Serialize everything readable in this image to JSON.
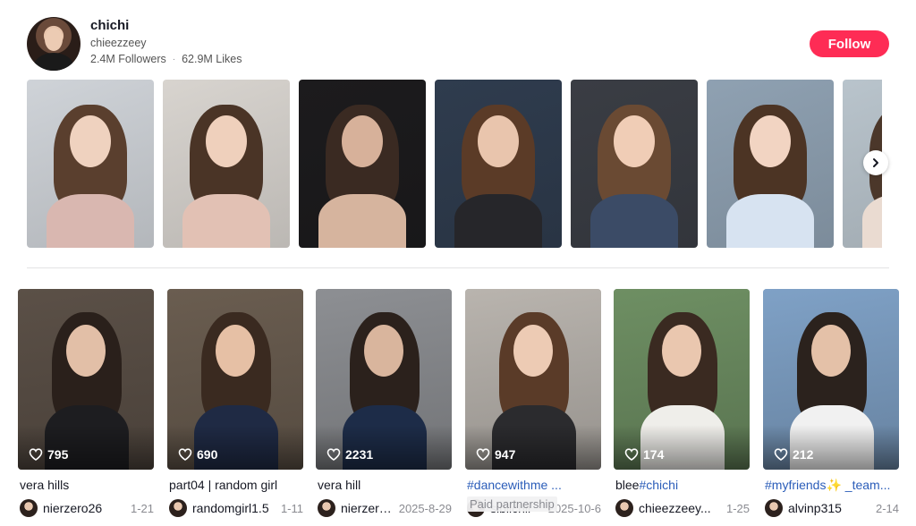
{
  "profile": {
    "name": "chichi",
    "handle": "chieezzeey",
    "followers": "2.4M Followers",
    "likes": "62.9M Likes",
    "follow_label": "Follow",
    "accent": "#fe2c55"
  },
  "stories": [
    {
      "bg": "#cfd3d8",
      "hair": "#5a3f2e",
      "top": "#d9b7b0",
      "skin": "#efd2bf"
    },
    {
      "bg": "#d8d4cf",
      "hair": "#4a3426",
      "top": "#e2c1b4",
      "skin": "#efd0bc"
    },
    {
      "bg": "#1c1b1d",
      "hair": "#3a2a22",
      "top": "#d6b49e",
      "skin": "#d7b19a"
    },
    {
      "bg": "#2f3c4e",
      "hair": "#5b3b27",
      "top": "#26262a",
      "skin": "#e9c5ad"
    },
    {
      "bg": "#3a3d44",
      "hair": "#6a4a33",
      "top": "#3b4b66",
      "skin": "#f0cdb6"
    },
    {
      "bg": "#8fa1b2",
      "hair": "#4c3424",
      "top": "#d7e3f1",
      "skin": "#f2d4c2"
    },
    {
      "bg": "#b9c4cc",
      "hair": "#4b372a",
      "top": "#eadbd1",
      "skin": "#eccab6"
    }
  ],
  "videos": [
    {
      "likes": "795",
      "caption": "vera hills",
      "tag": "",
      "author": "nierzero26",
      "date": "1-21",
      "bg": "#5b5047",
      "hair": "#2a201b",
      "top": "#1d1d20",
      "skin": "#e2bfa7"
    },
    {
      "likes": "690",
      "caption": "part04 | random girl",
      "tag": "",
      "author": "randomgirl1.5",
      "date": "1-11",
      "bg": "#6a5d50",
      "hair": "#3a2a20",
      "top": "#1f2a44",
      "skin": "#e6c0a5"
    },
    {
      "likes": "2231",
      "caption": "vera hill",
      "tag": "",
      "author": "nierzero26",
      "date": "2025-8-29",
      "bg": "#8d8f93",
      "hair": "#2b211c",
      "top": "#1d2c48",
      "skin": "#d9b59d"
    },
    {
      "likes": "947",
      "caption": "",
      "tag": "#dancewithme ...",
      "author": "sibiichii",
      "date": "2025-10-6",
      "bg": "#b9b4ae",
      "hair": "#5a3b28",
      "top": "#2b2b2e",
      "skin": "#edcbb4"
    },
    {
      "likes": "174",
      "caption": "blee",
      "tag": "#chichi",
      "author": "chieezzeey...",
      "date": "1-25",
      "bg": "#6e8f63",
      "hair": "#3a2a21",
      "top": "#efeeea",
      "skin": "#eac7af"
    },
    {
      "likes": "212",
      "caption": "",
      "tag": "#myfriends✨ _team...",
      "author": "alvinp315",
      "date": "2-14",
      "bg": "#7fa1c6",
      "hair": "#2b221d",
      "top": "#f1f1f1",
      "skin": "#e4c1a8"
    }
  ],
  "paid_label": "Paid partnership",
  "icons": {
    "heart": "heart-icon",
    "arrow": "chevron-right-icon"
  },
  "colors": {
    "hashtag": "#2b5db9",
    "muted": "#8a8b91",
    "divider": "#e3e3e4"
  }
}
